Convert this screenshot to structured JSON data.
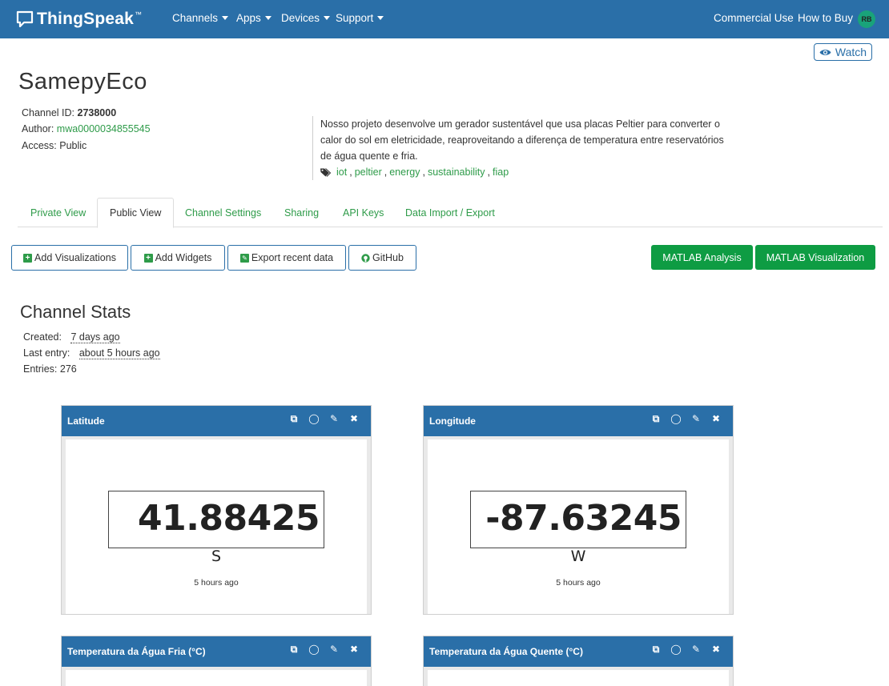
{
  "navbar": {
    "brand": "ThingSpeak",
    "brand_tm": "™",
    "menus": [
      "Channels",
      "Apps",
      "Devices",
      "Support"
    ],
    "right_links": [
      "Commercial Use",
      "How to Buy"
    ],
    "avatar_initials": "RB"
  },
  "watch_label": "Watch",
  "channel": {
    "title": "SamepyEco",
    "id_label": "Channel ID:",
    "id": "2738000",
    "author_label": "Author:",
    "author": "mwa0000034855545",
    "access_label": "Access:",
    "access": "Public",
    "description": "Nosso projeto desenvolve um gerador sustentável que usa placas Peltier para converter o calor do sol em eletricidade, reaproveitando a diferença de temperatura entre reservatórios de água quente e fria.",
    "tags": [
      "iot",
      "peltier",
      "energy",
      "sustainability",
      "fiap"
    ]
  },
  "tabs": [
    "Private View",
    "Public View",
    "Channel Settings",
    "Sharing",
    "API Keys",
    "Data Import / Export"
  ],
  "actions": {
    "add_visualizations": "Add Visualizations",
    "add_widgets": "Add Widgets",
    "export_recent": "Export recent data",
    "github": "GitHub",
    "matlab_analysis": "MATLAB Analysis",
    "matlab_visualization": "MATLAB Visualization"
  },
  "stats": {
    "title": "Channel Stats",
    "created_label": "Created:",
    "created": "7 days ago",
    "last_entry_label": "Last entry:",
    "last_entry": "about 5 hours ago",
    "entries_label": "Entries:",
    "entries": "276"
  },
  "widgets": [
    {
      "title": "Latitude",
      "value": "41.88425",
      "unit": "S",
      "time": "5 hours ago"
    },
    {
      "title": "Longitude",
      "value": "-87.63245",
      "unit": "W",
      "time": "5 hours ago"
    },
    {
      "title": "Temperatura da Água Fria (°C)"
    },
    {
      "title": "Temperatura da Água Quente (°C)"
    }
  ],
  "colors": {
    "navbar": "#2a6fa8",
    "link_green": "#2e9b49",
    "matlab_green": "#0e9c43"
  }
}
